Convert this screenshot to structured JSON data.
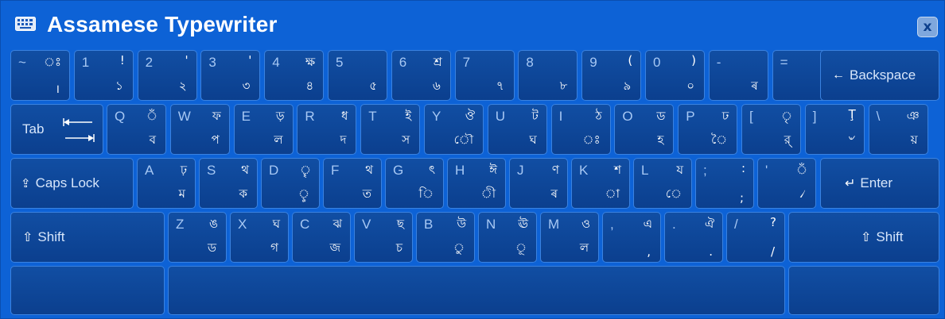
{
  "window": {
    "title": "Assamese Typewriter",
    "close_label": "x",
    "icon": "keyboard-icon"
  },
  "colors": {
    "background": "#0d62d6",
    "key": "#0b3f8e",
    "key_border": "#3a82e0",
    "primary_glyph": "#a7c8f4",
    "secondary_glyph": "#ffffff"
  },
  "special_keys": {
    "backspace": "Backspace",
    "tab": "Tab",
    "caps_lock": "Caps Lock",
    "enter": "Enter",
    "shift_left": "Shift",
    "shift_right": "Shift"
  },
  "rows": {
    "row1": [
      {
        "id": "tilde",
        "en": "~",
        "shift": "ঃ",
        "base": "।"
      },
      {
        "id": "1",
        "en": "1",
        "shift": "!",
        "base": "১"
      },
      {
        "id": "2",
        "en": "2",
        "shift": "'",
        "base": "২"
      },
      {
        "id": "3",
        "en": "3",
        "shift": "'",
        "base": "৩"
      },
      {
        "id": "4",
        "en": "4",
        "shift": "ক্ষ",
        "base": "৪"
      },
      {
        "id": "5",
        "en": "5",
        "shift": "",
        "base": "৫"
      },
      {
        "id": "6",
        "en": "6",
        "shift": "শ্ৰ",
        "base": "৬"
      },
      {
        "id": "7",
        "en": "7",
        "shift": "",
        "base": "৭"
      },
      {
        "id": "8",
        "en": "8",
        "shift": "",
        "base": "৮"
      },
      {
        "id": "9",
        "en": "9",
        "shift": "(",
        "base": "৯"
      },
      {
        "id": "0",
        "en": "0",
        "shift": ")",
        "base": "০"
      },
      {
        "id": "minus",
        "en": "-",
        "shift": "",
        "base": "ৰ"
      },
      {
        "id": "equals",
        "en": "=",
        "shift": "",
        "base": ""
      }
    ],
    "row2": [
      {
        "id": "q",
        "en": "Q",
        "shift": "ঁ",
        "base": "ব"
      },
      {
        "id": "w",
        "en": "W",
        "shift": "ফ",
        "base": "প"
      },
      {
        "id": "e",
        "en": "E",
        "shift": "ড়",
        "base": "ল"
      },
      {
        "id": "r",
        "en": "R",
        "shift": "ধ",
        "base": "দ"
      },
      {
        "id": "t",
        "en": "T",
        "shift": "ই",
        "base": "স"
      },
      {
        "id": "y",
        "en": "Y",
        "shift": "ঔ",
        "base": "ৌ"
      },
      {
        "id": "u",
        "en": "U",
        "shift": "ট",
        "base": "ঘ"
      },
      {
        "id": "i",
        "en": "I",
        "shift": "ঠ",
        "base": "ঃ"
      },
      {
        "id": "o",
        "en": "O",
        "shift": "ড",
        "base": "হ"
      },
      {
        "id": "p",
        "en": "P",
        "shift": "ঢ",
        "base": "ৈ"
      },
      {
        "id": "lbracket",
        "en": "[",
        "shift": "ৃ",
        "base": "র্"
      },
      {
        "id": "rbracket",
        "en": "]",
        "shift": "Ţ",
        "base": "৺"
      },
      {
        "id": "backslash",
        "en": "\\",
        "shift": "ঞ",
        "base": "য়"
      }
    ],
    "row3": [
      {
        "id": "a",
        "en": "A",
        "shift": "ঢ়",
        "base": "ম"
      },
      {
        "id": "s",
        "en": "S",
        "shift": "থ",
        "base": "ক"
      },
      {
        "id": "d",
        "en": "D",
        "shift": "ৄ",
        "base": "ৢ"
      },
      {
        "id": "f",
        "en": "F",
        "shift": "থ",
        "base": "ত"
      },
      {
        "id": "g",
        "en": "G",
        "shift": "ৎ",
        "base": "ি"
      },
      {
        "id": "h",
        "en": "H",
        "shift": "ঈ",
        "base": "ী"
      },
      {
        "id": "j",
        "en": "J",
        "shift": "ণ",
        "base": "ৰ"
      },
      {
        "id": "k",
        "en": "K",
        "shift": "শ",
        "base": "া"
      },
      {
        "id": "l",
        "en": "L",
        "shift": "য",
        "base": "ে"
      },
      {
        "id": "semicolon",
        "en": ";",
        "shift": ":",
        "base": ";"
      },
      {
        "id": "quote",
        "en": "'",
        "shift": "ঁ",
        "base": "৴"
      }
    ],
    "row4": [
      {
        "id": "z",
        "en": "Z",
        "shift": "ঙ",
        "base": "ড"
      },
      {
        "id": "x",
        "en": "X",
        "shift": "ঘ",
        "base": "গ"
      },
      {
        "id": "c",
        "en": "C",
        "shift": "ঝ",
        "base": "জ"
      },
      {
        "id": "v",
        "en": "V",
        "shift": "ছ",
        "base": "চ"
      },
      {
        "id": "b",
        "en": "B",
        "shift": "উ",
        "base": "ু"
      },
      {
        "id": "n",
        "en": "N",
        "shift": "ঊ",
        "base": "ূ"
      },
      {
        "id": "m",
        "en": "M",
        "shift": "ও",
        "base": "ল"
      },
      {
        "id": "comma",
        "en": ",",
        "shift": "এ",
        "base": ","
      },
      {
        "id": "period",
        "en": ".",
        "shift": "ঐ",
        "base": "."
      },
      {
        "id": "slash",
        "en": "/",
        "shift": "?",
        "base": "/"
      }
    ]
  }
}
